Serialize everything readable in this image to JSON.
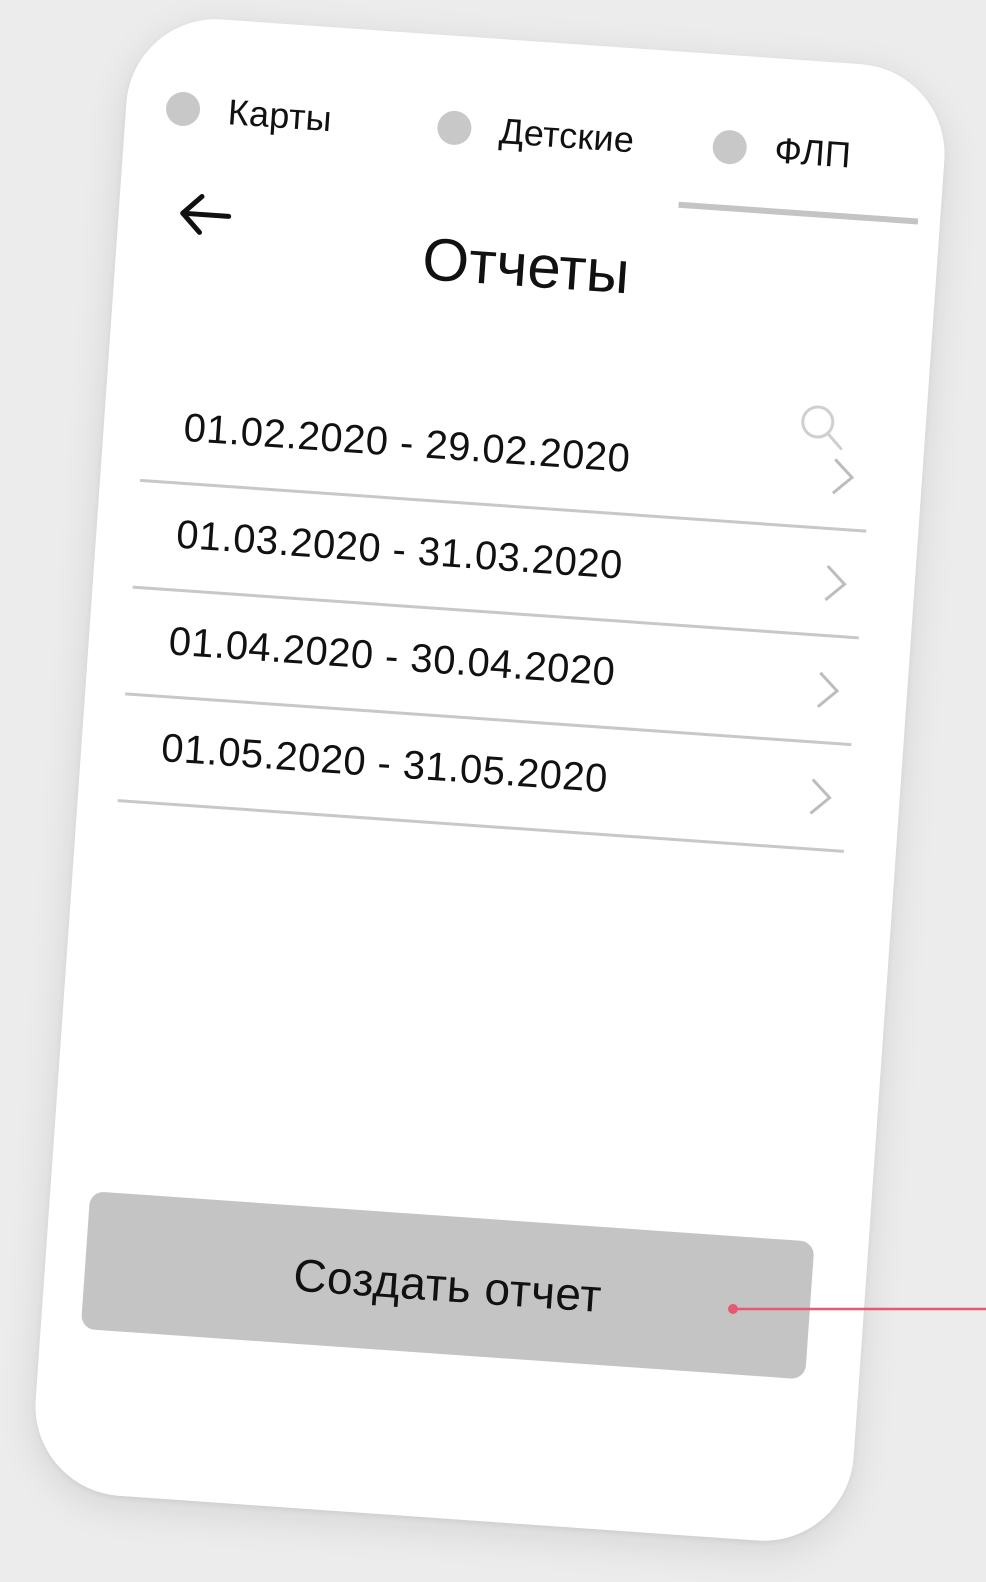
{
  "tabs": [
    {
      "label": "Карты",
      "active": false
    },
    {
      "label": "Детские",
      "active": false
    },
    {
      "label": "ФЛП",
      "active": true
    }
  ],
  "header": {
    "title": "Отчеты",
    "back_icon": "arrow-left-icon",
    "search_icon": "search-icon"
  },
  "reports": [
    {
      "period": "01.02.2020 - 29.02.2020"
    },
    {
      "period": "01.03.2020 - 31.03.2020"
    },
    {
      "period": "01.04.2020 - 30.04.2020"
    },
    {
      "period": "01.05.2020 - 31.05.2020"
    }
  ],
  "actions": {
    "create_label": "Создать отчет"
  },
  "colors": {
    "background": "#ececec",
    "card": "#ffffff",
    "placeholder_gray": "#c4c4c4",
    "divider": "#c8c8c8",
    "annotation": "#e8586e"
  }
}
